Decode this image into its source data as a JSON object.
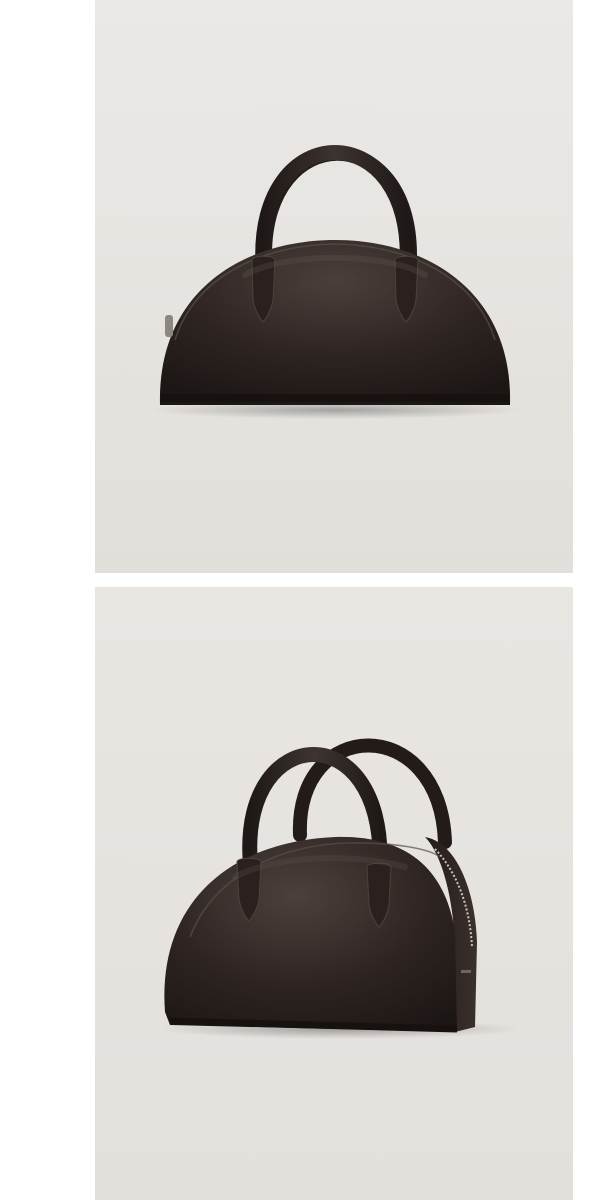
{
  "gallery": {
    "images": [
      {
        "subject": "handbag-front-view",
        "background_color": "#e6e3df",
        "leather_color": "#2c2320"
      },
      {
        "subject": "handbag-angled-view",
        "background_color": "#e6e3df",
        "leather_color": "#2c2320"
      }
    ]
  }
}
